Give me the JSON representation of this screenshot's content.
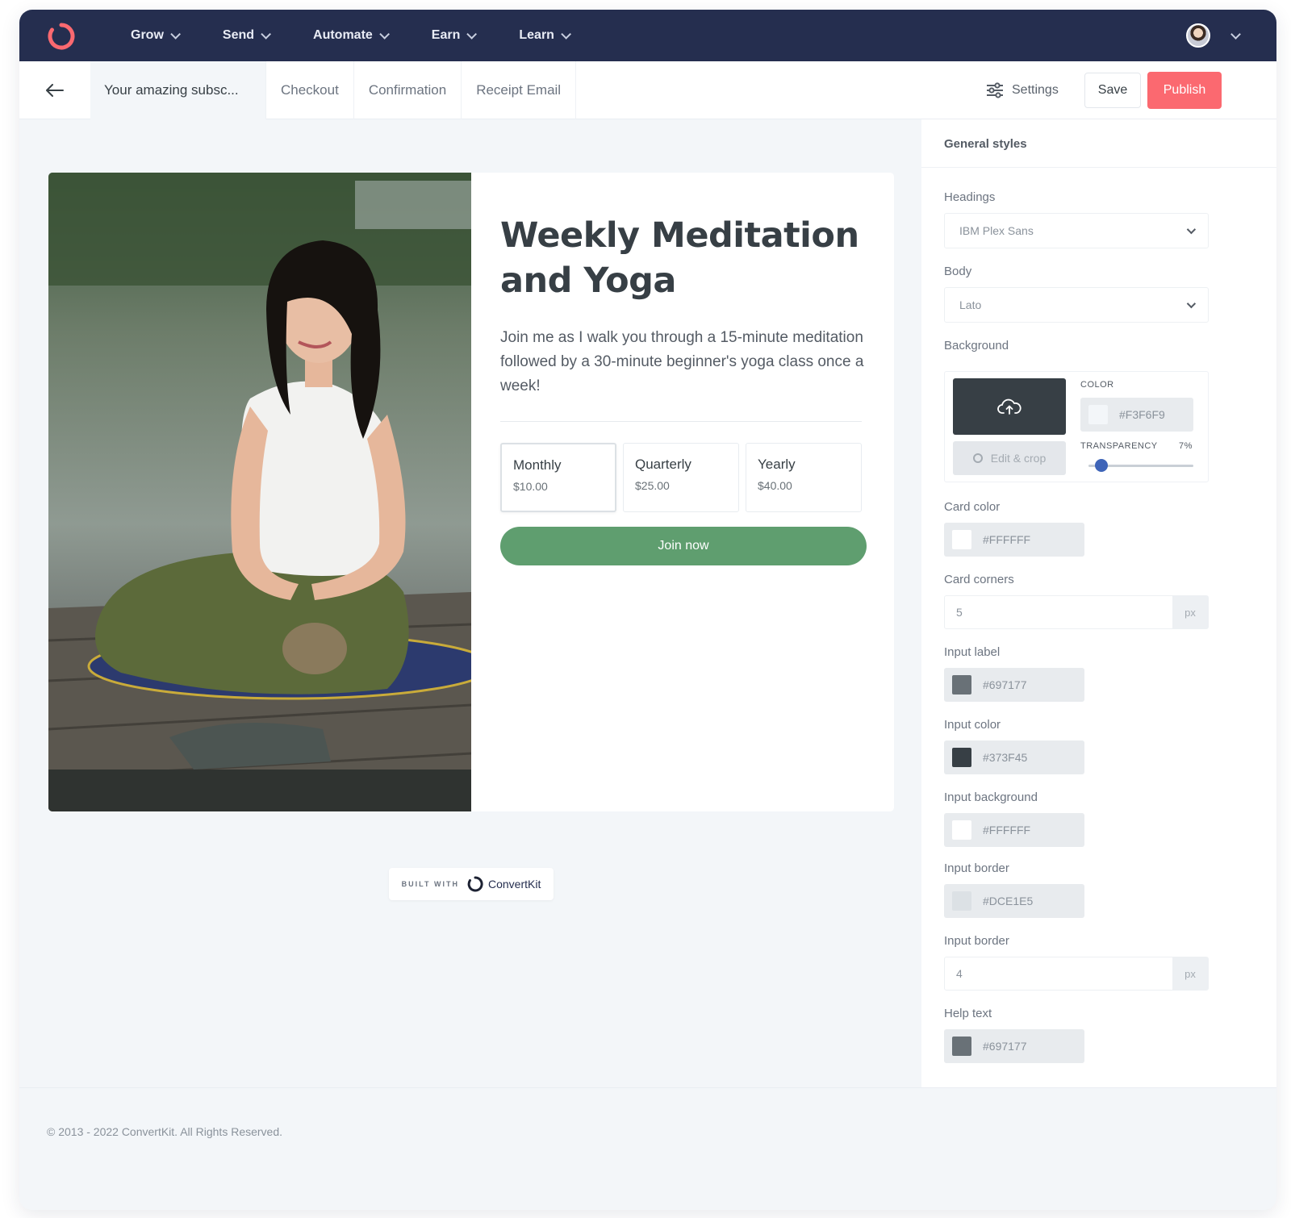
{
  "nav": {
    "items": [
      {
        "label": "Grow"
      },
      {
        "label": "Send"
      },
      {
        "label": "Automate"
      },
      {
        "label": "Earn"
      },
      {
        "label": "Learn"
      }
    ]
  },
  "toolbar": {
    "tabs": [
      {
        "label": "Your amazing subsc..."
      },
      {
        "label": "Checkout"
      },
      {
        "label": "Confirmation"
      },
      {
        "label": "Receipt Email"
      }
    ],
    "settings_label": "Settings",
    "save_label": "Save",
    "publish_label": "Publish"
  },
  "card": {
    "title_line1": "Weekly Meditation",
    "title_line2": "and Yoga",
    "description": "Join me as I walk you through a 15-minute meditation followed by a 30-minute beginner's yoga class once a week!",
    "plans": [
      {
        "name": "Monthly",
        "price": "$10.00"
      },
      {
        "name": "Quarterly",
        "price": "$25.00"
      },
      {
        "name": "Yearly",
        "price": "$40.00"
      }
    ],
    "join_label": "Join now"
  },
  "built_with": {
    "small": "BUILT WITH",
    "brand": "ConvertKit"
  },
  "footer": {
    "text": "© 2013 - 2022 ConvertKit. All Rights Reserved."
  },
  "panel": {
    "title": "General styles",
    "headings_label": "Headings",
    "headings_value": "IBM Plex Sans",
    "body_label": "Body",
    "body_value": "Lato",
    "background_label": "Background",
    "bg_color_label": "COLOR",
    "bg_color_value": "#F3F6F9",
    "edit_crop_label": "Edit & crop",
    "transparency_label": "TRANSPARENCY",
    "transparency_value": "7%",
    "card_color_label": "Card color",
    "card_color_value": "#FFFFFF",
    "card_corners_label": "Card corners",
    "card_corners_value": "5",
    "px_unit": "px",
    "input_label_label": "Input label",
    "input_label_value": "#697177",
    "input_color_label": "Input color",
    "input_color_value": "#373F45",
    "input_background_label": "Input background",
    "input_background_value": "#FFFFFF",
    "input_border_color_label": "Input border",
    "input_border_color_value": "#DCE1E5",
    "input_border_width_label": "Input border",
    "input_border_width_value": "4",
    "help_text_label": "Help text",
    "help_text_value": "#697177"
  },
  "colors": {
    "nav_bg": "#252E4F",
    "publish": "#FB6970",
    "join": "#5F9E6F",
    "canvas_bg": "#F3F6F9",
    "slider": "#3E64B8"
  }
}
